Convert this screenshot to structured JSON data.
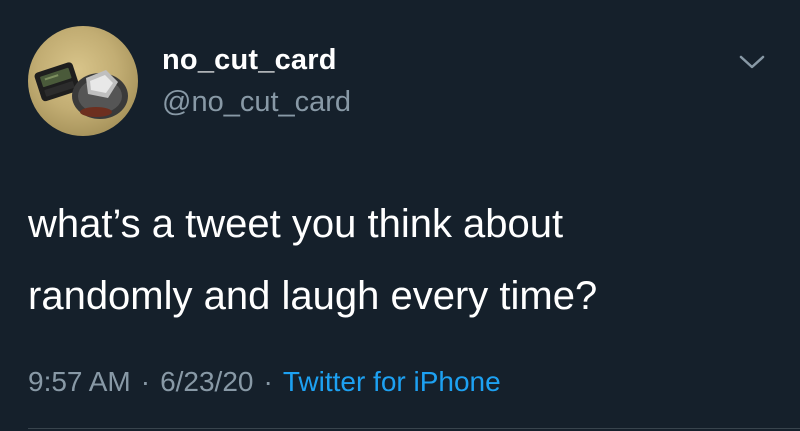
{
  "tweet": {
    "author": {
      "display_name": "no_cut_card",
      "handle": "@no_cut_card",
      "avatar_icon": "avatar-photo"
    },
    "text_lines": [
      "what’s a tweet you think about",
      "randomly and laugh every time?"
    ],
    "meta": {
      "time": "9:57 AM",
      "separator": "·",
      "date": "6/23/20",
      "source": "Twitter for iPhone"
    },
    "menu_icon": "chevron-down-icon"
  },
  "colors": {
    "background": "#15202b",
    "primary_text": "#ffffff",
    "secondary_text": "#8899a6",
    "link": "#1da1f2"
  }
}
